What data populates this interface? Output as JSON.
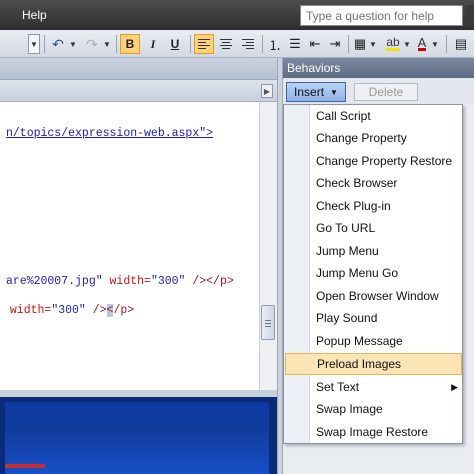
{
  "menubar": {
    "help_label": "Help",
    "question_placeholder": "Type a question for help"
  },
  "toolbar": {
    "bold": "B",
    "italic": "I",
    "underline": "U"
  },
  "code": {
    "line1": "n/topics/expression-web.aspx\">",
    "line2_a": "are%20007.jpg\"",
    "line2_b": " width=",
    "line2_c": "\"300\"",
    "line2_d": " /></p>",
    "line3_a": " width=",
    "line3_b": "\"300\"",
    "line3_c": " />",
    "line3_d": "<",
    "line3_e": "/p>"
  },
  "behaviors": {
    "title": "Behaviors",
    "insert_label": "Insert",
    "delete_label": "Delete",
    "items": [
      {
        "label": "Call Script"
      },
      {
        "label": "Change Property"
      },
      {
        "label": "Change Property Restore"
      },
      {
        "label": "Check Browser"
      },
      {
        "label": "Check Plug-in"
      },
      {
        "label": "Go To URL"
      },
      {
        "label": "Jump Menu"
      },
      {
        "label": "Jump Menu Go"
      },
      {
        "label": "Open Browser Window"
      },
      {
        "label": "Play Sound"
      },
      {
        "label": "Popup Message"
      },
      {
        "label": "Preload Images"
      },
      {
        "label": "Set Text"
      },
      {
        "label": "Swap Image"
      },
      {
        "label": "Swap Image Restore"
      }
    ],
    "highlighted_item": "Preload Images",
    "submenu_item": "Set Text"
  },
  "colors": {
    "menubar": "#3a3a3a",
    "highlight": "#fbe5b4",
    "insert_button": "#a4c3ee",
    "design_view": "#123c9c"
  }
}
